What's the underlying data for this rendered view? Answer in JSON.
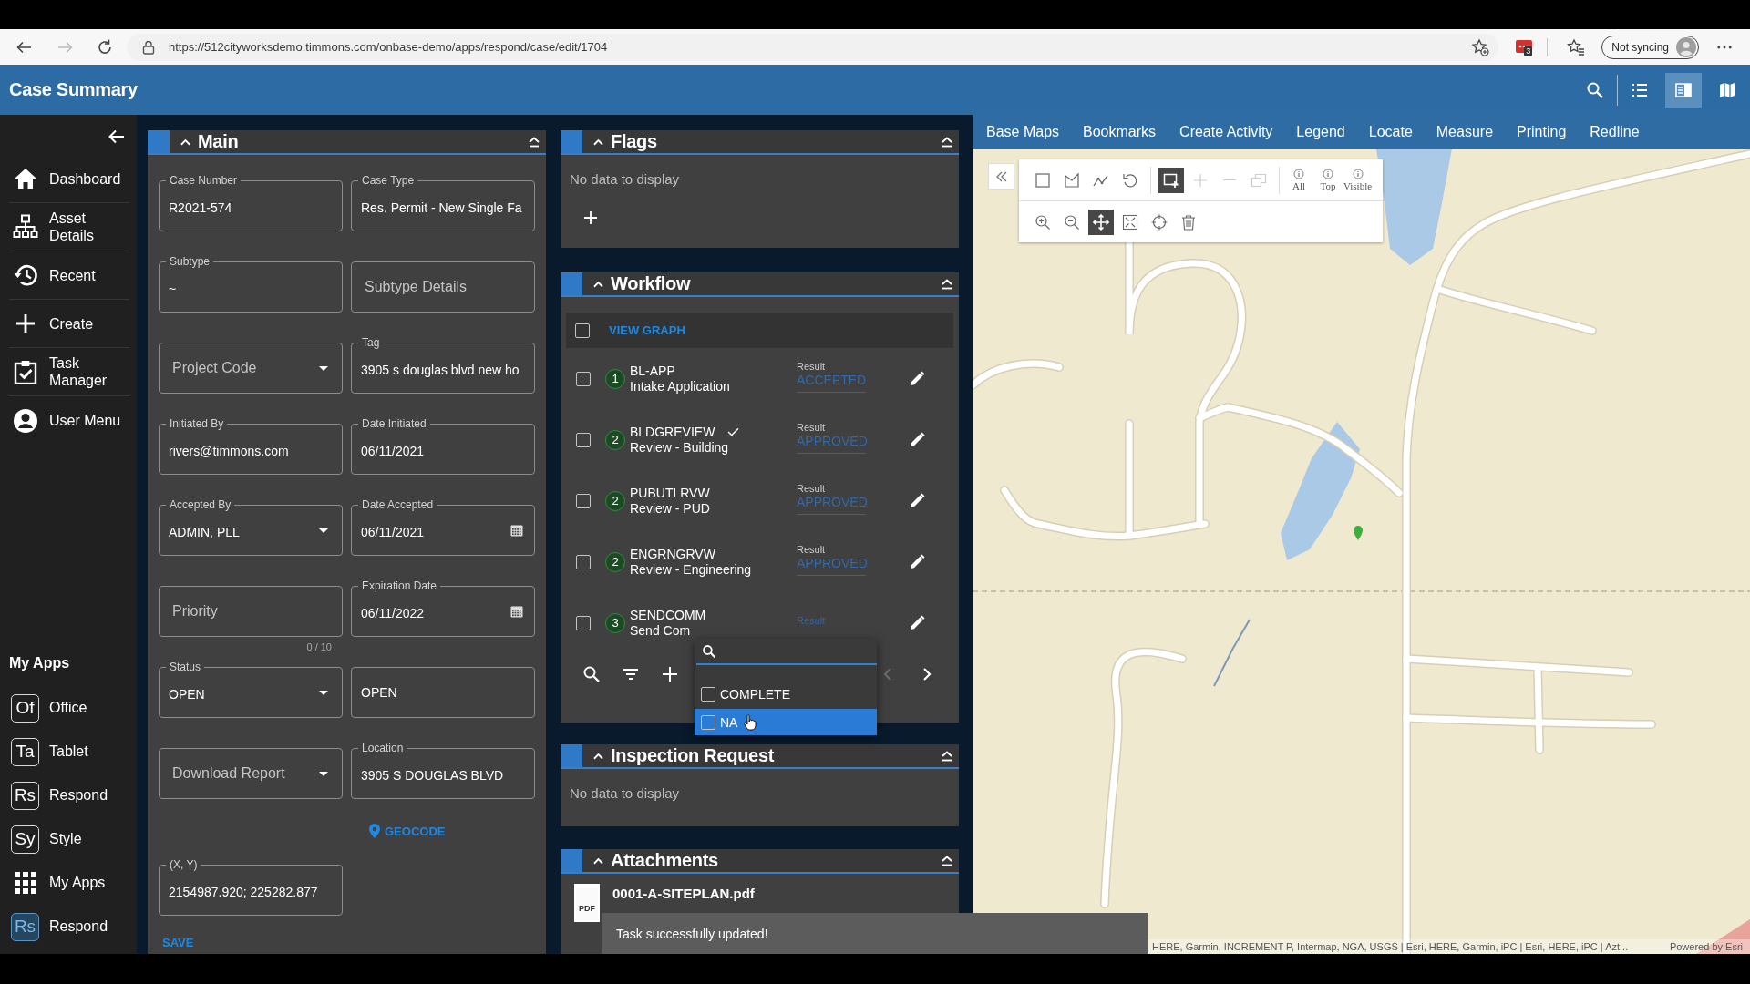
{
  "browser": {
    "nav_buttons": [
      {
        "kind": "back",
        "disabled": false
      },
      {
        "kind": "forward",
        "disabled": true
      },
      {
        "kind": "reload",
        "disabled": false
      }
    ],
    "url": "https://512cityworksdemo.timmons.com/onbase-demo/apps/respond/case/edit/1704",
    "extension_badge": "3",
    "profile_button": "Not syncing"
  },
  "app_header": {
    "title": "Case Summary",
    "view_buttons": [
      {
        "kind": "list",
        "selected": false
      },
      {
        "kind": "split",
        "selected": true
      },
      {
        "kind": "map",
        "selected": false
      }
    ]
  },
  "sidebar": {
    "nav_items": [
      {
        "label": "Dashboard"
      },
      {
        "label": "Asset Details"
      },
      {
        "label": "Recent"
      },
      {
        "label": "Create"
      },
      {
        "label": "Task Manager"
      },
      {
        "label": "User Menu"
      }
    ],
    "apps_heading": "My Apps",
    "apps": [
      {
        "kind": "badge",
        "badge": "Of",
        "label": "Office",
        "selected": false
      },
      {
        "kind": "badge",
        "badge": "Ta",
        "label": "Tablet",
        "selected": false
      },
      {
        "kind": "badge",
        "badge": "Rs",
        "label": "Respond",
        "selected": false
      },
      {
        "kind": "badge",
        "badge": "Sy",
        "label": "Style",
        "selected": false
      },
      {
        "kind": "grid",
        "label": "My Apps",
        "selected": false
      },
      {
        "kind": "badge",
        "badge": "Rs",
        "label": "Respond",
        "selected": true
      }
    ]
  },
  "main": {
    "title": "Main",
    "rows": [
      {
        "fields": [
          {
            "kind": "text",
            "label": "Case Number",
            "value": "R2021-574"
          },
          {
            "kind": "text",
            "label": "Case Type",
            "value": "Res. Permit - New Single Fa"
          }
        ]
      },
      {
        "fields": [
          {
            "kind": "text",
            "label": "Subtype",
            "value": "~"
          },
          {
            "kind": "text",
            "placeholder": "Subtype Details"
          }
        ]
      },
      {
        "fields": [
          {
            "kind": "select",
            "placeholder": "Project Code"
          },
          {
            "kind": "text",
            "label": "Tag",
            "value": "3905 s douglas blvd new ho"
          }
        ]
      },
      {
        "fields": [
          {
            "kind": "text",
            "label": "Initiated By",
            "value": "rivers@timmons.com"
          },
          {
            "kind": "text",
            "label": "Date Initiated",
            "value": "06/11/2021"
          }
        ]
      },
      {
        "fields": [
          {
            "kind": "select",
            "label": "Accepted By",
            "value": "ADMIN, PLL"
          },
          {
            "kind": "date",
            "label": "Date Accepted",
            "value": "06/11/2021"
          }
        ]
      },
      {
        "fields": [
          {
            "kind": "text",
            "placeholder": "Priority",
            "counter": "0 / 10"
          },
          {
            "kind": "date",
            "label": "Expiration Date",
            "value": "06/11/2022"
          }
        ]
      },
      {
        "fields": [
          {
            "kind": "select",
            "label": "Status",
            "value": "OPEN"
          },
          {
            "kind": "text",
            "value": "OPEN"
          }
        ]
      },
      {
        "fields": [
          {
            "kind": "select",
            "placeholder": "Download Report"
          },
          {
            "kind": "text",
            "label": "Location",
            "value": "3905 S DOUGLAS BLVD"
          }
        ]
      }
    ],
    "geocode_link": "GEOCODE",
    "coordinates": {
      "label": "(X, Y)",
      "value": "2154987.920; 225282.877"
    },
    "save_link": "SAVE"
  },
  "flags": {
    "title": "Flags",
    "empty_text": "No data to display"
  },
  "workflow": {
    "title": "Workflow",
    "view_graph": {
      "label": "VIEW GRAPH",
      "checked": false
    },
    "tasks": [
      {
        "checked": false,
        "step": "1",
        "code": "BL-APP",
        "name": "Intake Application",
        "ticked": false,
        "result_label": "Result",
        "result": "ACCEPTED",
        "result_open": false
      },
      {
        "checked": false,
        "step": "2",
        "code": "BLDGREVIEW",
        "name": "Review - Building",
        "ticked": true,
        "result_label": "Result",
        "result": "APPROVED",
        "result_open": false
      },
      {
        "checked": false,
        "step": "2",
        "code": "PUBUTLRVW",
        "name": "Review - PUD",
        "ticked": false,
        "result_label": "Result",
        "result": "APPROVED",
        "result_open": false
      },
      {
        "checked": false,
        "step": "2",
        "code": "ENGRNGRVW",
        "name": "Review - Engineering",
        "ticked": false,
        "result_label": "Result",
        "result": "APPROVED",
        "result_open": false
      },
      {
        "checked": false,
        "step": "3",
        "code": "SENDCOMM",
        "name": "Send Com",
        "ticked": false,
        "result_label": "Result",
        "result_open": true
      }
    ],
    "result_menu": {
      "options": [
        {
          "label": "COMPLETE",
          "checked": false,
          "selected": false
        },
        {
          "label": "NA",
          "checked": false,
          "selected": true
        }
      ]
    },
    "pager": [
      {
        "kind": "prev",
        "disabled": true
      },
      {
        "kind": "next",
        "disabled": false
      }
    ]
  },
  "inspection_request": {
    "title": "Inspection Request",
    "empty_text": "No data to display"
  },
  "attachments": {
    "title": "Attachments",
    "files": [
      {
        "type": "PDF",
        "name": "0001-A-SITEPLAN.pdf"
      }
    ]
  },
  "map": {
    "menu": [
      "Base Maps",
      "Bookmarks",
      "Create Activity",
      "Legend",
      "Locate",
      "Measure",
      "Printing",
      "Redline"
    ],
    "tool_rows": [
      {
        "groups": [
          {
            "tools": [
              {
                "kind": "rectangle",
                "selected": false,
                "disabled": false
              },
              {
                "kind": "polygon",
                "selected": false,
                "disabled": false
              },
              {
                "kind": "polyline",
                "selected": false,
                "disabled": false
              },
              {
                "kind": "undo",
                "selected": false,
                "disabled": false
              }
            ]
          },
          {
            "tools": [
              {
                "kind": "add-shape",
                "selected": true,
                "disabled": false
              },
              {
                "kind": "plus",
                "selected": false,
                "disabled": true
              },
              {
                "kind": "minus",
                "selected": false,
                "disabled": true
              },
              {
                "kind": "copy",
                "selected": false,
                "disabled": true
              }
            ]
          },
          {
            "tools": [
              {
                "kind": "info",
                "label": "All",
                "selected": false,
                "disabled": false
              },
              {
                "kind": "info",
                "label": "Top",
                "selected": false,
                "disabled": false
              },
              {
                "kind": "info",
                "label": "Visible",
                "selected": false,
                "disabled": false
              }
            ]
          }
        ]
      },
      {
        "groups": [
          {
            "tools": [
              {
                "kind": "zoom-in",
                "selected": false,
                "disabled": false
              },
              {
                "kind": "zoom-out",
                "selected": false,
                "disabled": false
              },
              {
                "kind": "pan",
                "selected": true,
                "disabled": false
              },
              {
                "kind": "extent",
                "selected": false,
                "disabled": false
              },
              {
                "kind": "target",
                "selected": false,
                "disabled": false
              },
              {
                "kind": "trash",
                "selected": false,
                "disabled": false
              }
            ]
          }
        ]
      }
    ],
    "attribution": "HERE, Garmin, INCREMENT P, Intermap, NGA, USGS | Esri, HERE, Garmin, iPC | Esri, HERE, iPC | Azt...",
    "powered_by": "Powered by Esri"
  },
  "toast": {
    "message": "Task successfully updated!"
  }
}
